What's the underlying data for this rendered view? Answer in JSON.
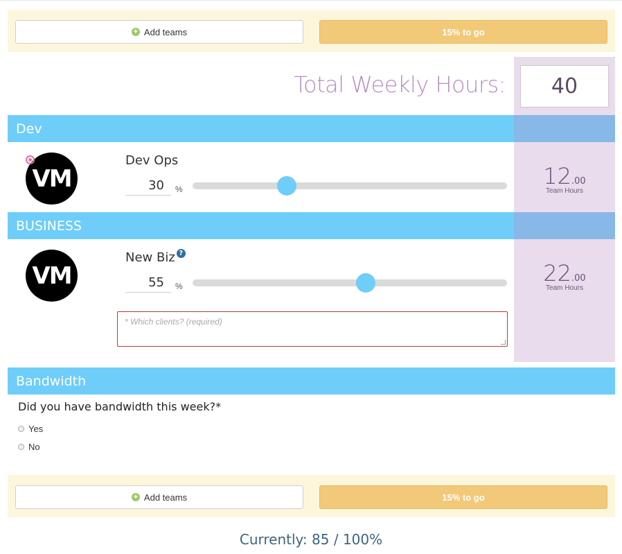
{
  "action_bar": {
    "add_teams_label": "Add teams",
    "progress_label": "15% to go"
  },
  "total": {
    "label": "Total Weekly Hours:",
    "value": "40"
  },
  "sections": {
    "dev": {
      "title": "Dev",
      "team": {
        "avatar_text": "VM",
        "name": "Dev Ops",
        "percent": "30",
        "percent_sign": "%",
        "slider_fraction": 0.3,
        "hours_whole": "12",
        "hours_fraction": ".00",
        "hours_caption": "Team Hours"
      }
    },
    "business": {
      "title": "BUSINESS",
      "team": {
        "avatar_text": "VM",
        "name": "New Biz",
        "help_glyph": "?",
        "percent": "55",
        "percent_sign": "%",
        "slider_fraction": 0.55,
        "hours_whole": "22",
        "hours_fraction": ".00",
        "hours_caption": "Team Hours",
        "clients_placeholder": "* Which clients? (required)"
      }
    },
    "bandwidth": {
      "title": "Bandwidth",
      "question": "Did you have bandwidth this week?*",
      "options": [
        "Yes",
        "No"
      ]
    }
  },
  "footer": {
    "currently_label": "Currently:",
    "current_value": "85",
    "total_value": "/ 100%"
  },
  "colors": {
    "section_header": "#6ecdf9",
    "hours_column": "#e9dced",
    "progress_button": "#f2c978",
    "action_bar_bg": "#fcf6dc"
  }
}
